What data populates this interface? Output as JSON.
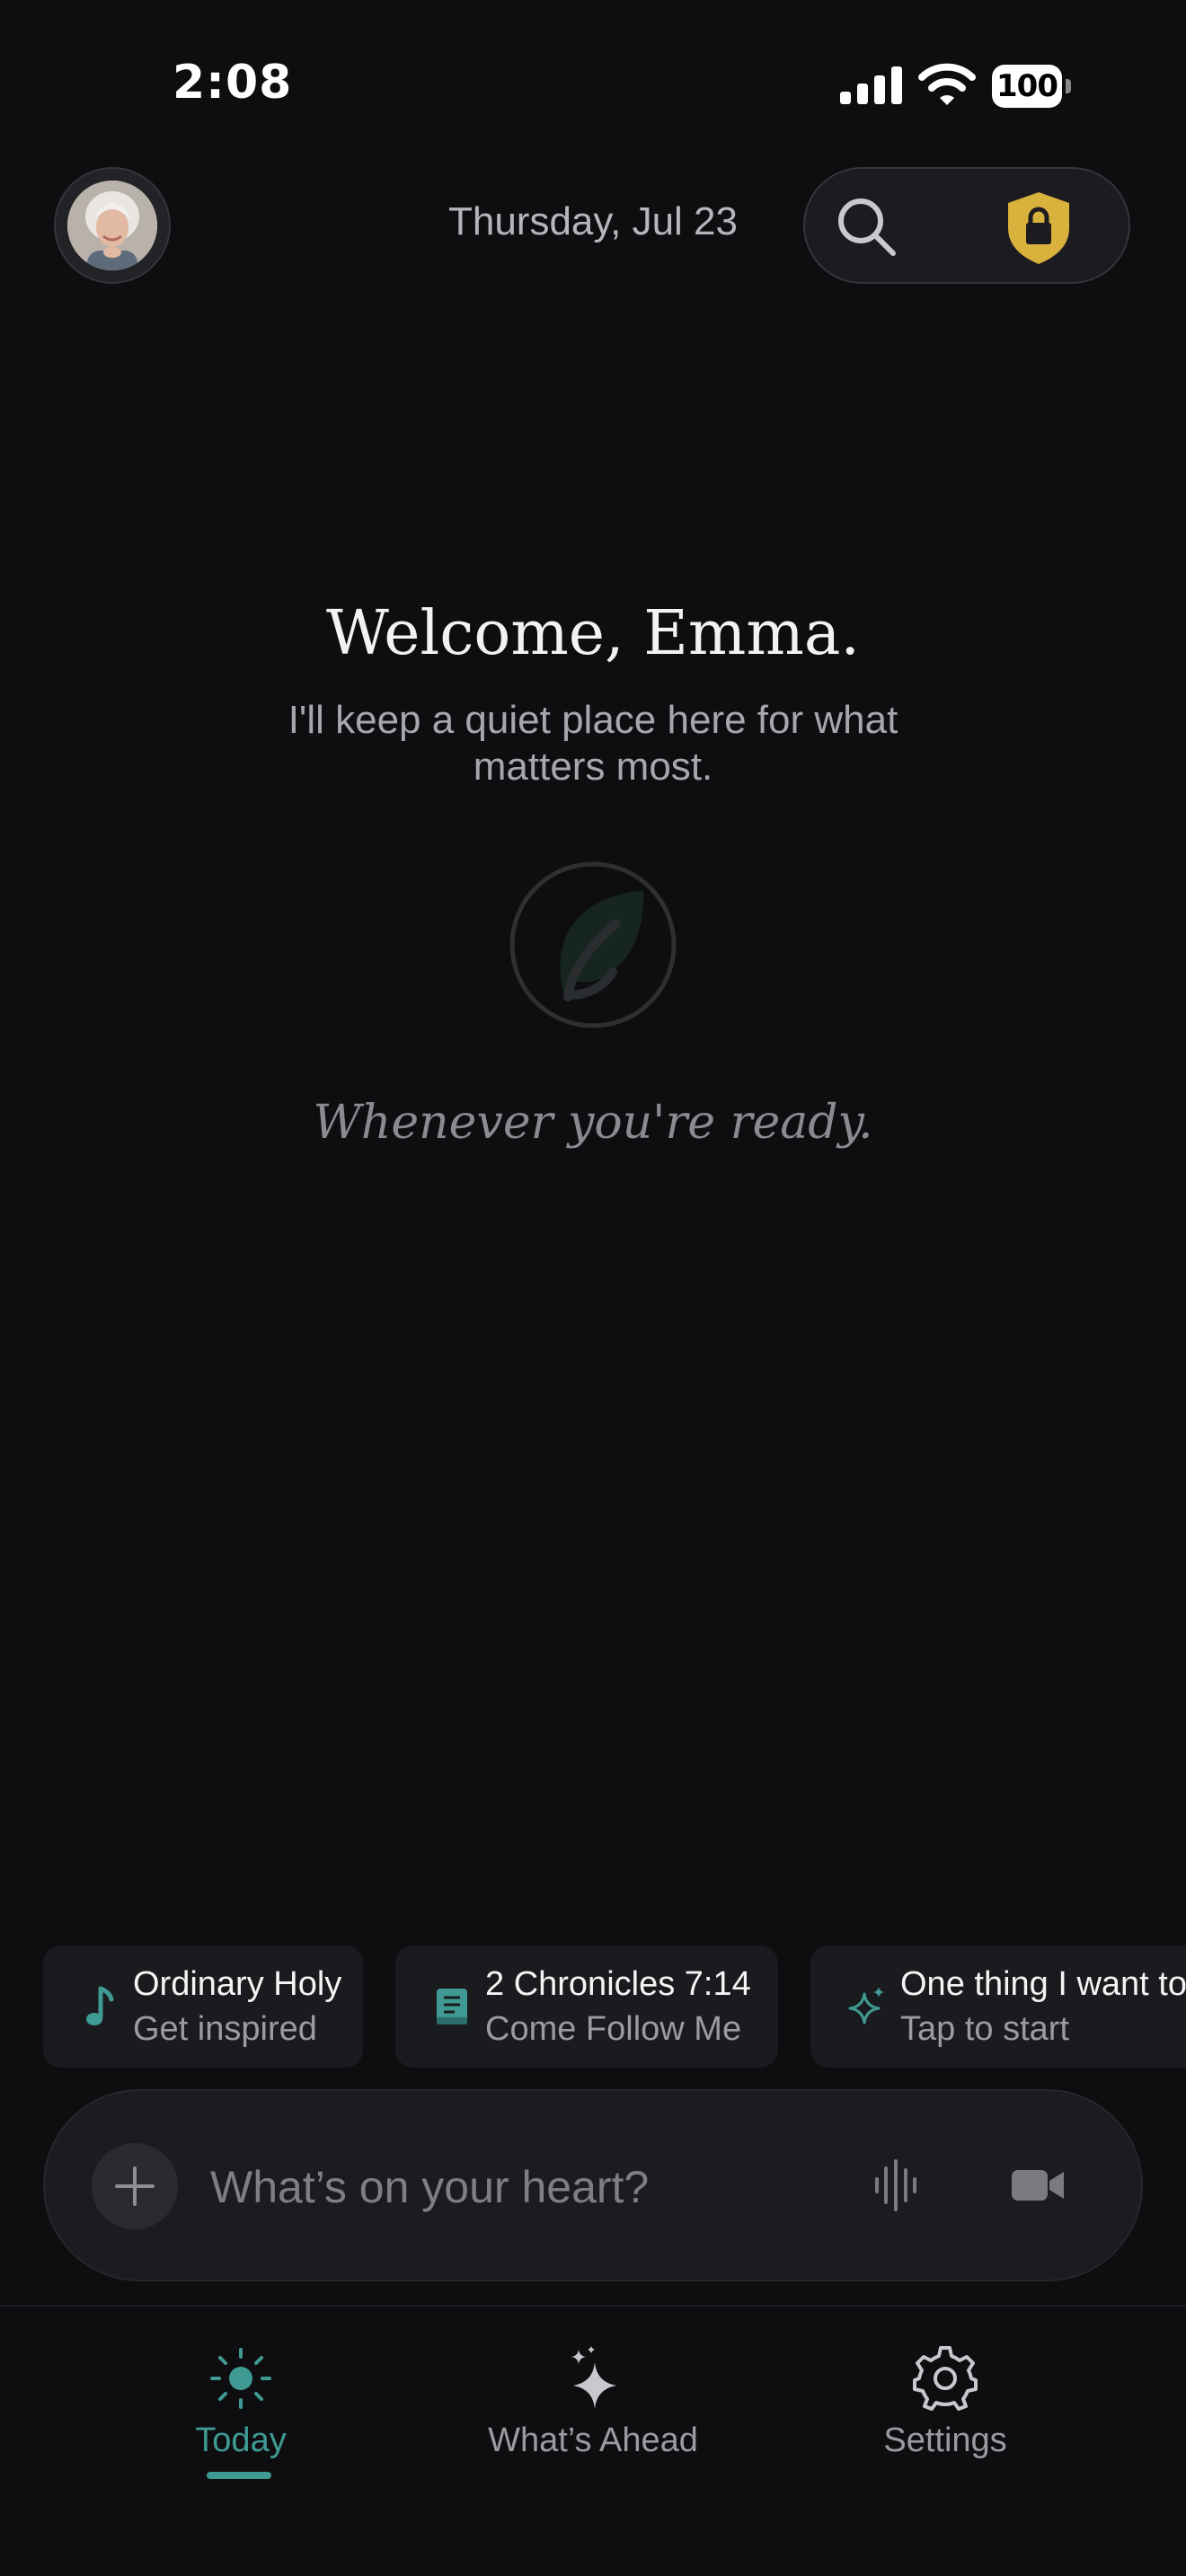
{
  "status_bar": {
    "time": "2:08",
    "battery": "100",
    "icons": [
      "cellular-signal-icon",
      "wifi-icon",
      "battery-icon"
    ]
  },
  "header": {
    "date": "Thursday, Jul 23",
    "avatar": "profile-photo",
    "search_icon": "search-icon",
    "lock_icon": "shield-lock-icon",
    "accent_color": "#d8b23c"
  },
  "hero": {
    "welcome": "Welcome, Emma.",
    "subtitle": "I'll keep a quiet place here for what matters most.",
    "emblem_icon": "leaf-icon",
    "prompt": "Whenever you're ready."
  },
  "suggestions": [
    {
      "icon": "music-note-icon",
      "title": "Ordinary Holy",
      "subtitle": "Get inspired"
    },
    {
      "icon": "book-icon",
      "title": "2 Chronicles 7:14",
      "subtitle": "Come Follow Me"
    },
    {
      "icon": "sparkle-icon",
      "title": "One thing I want to",
      "subtitle": "Tap to start"
    }
  ],
  "composer": {
    "placeholder": "What’s on your heart?",
    "icons": [
      "plus-icon",
      "voice-waveform-icon",
      "video-camera-icon"
    ]
  },
  "tab_bar": {
    "active_color": "#3f9a93",
    "tabs": [
      {
        "label": "Today",
        "icon": "sun-icon",
        "active": true
      },
      {
        "label": "What’s Ahead",
        "icon": "sparkles-icon",
        "active": false
      },
      {
        "label": "Settings",
        "icon": "gear-icon",
        "active": false
      }
    ]
  }
}
